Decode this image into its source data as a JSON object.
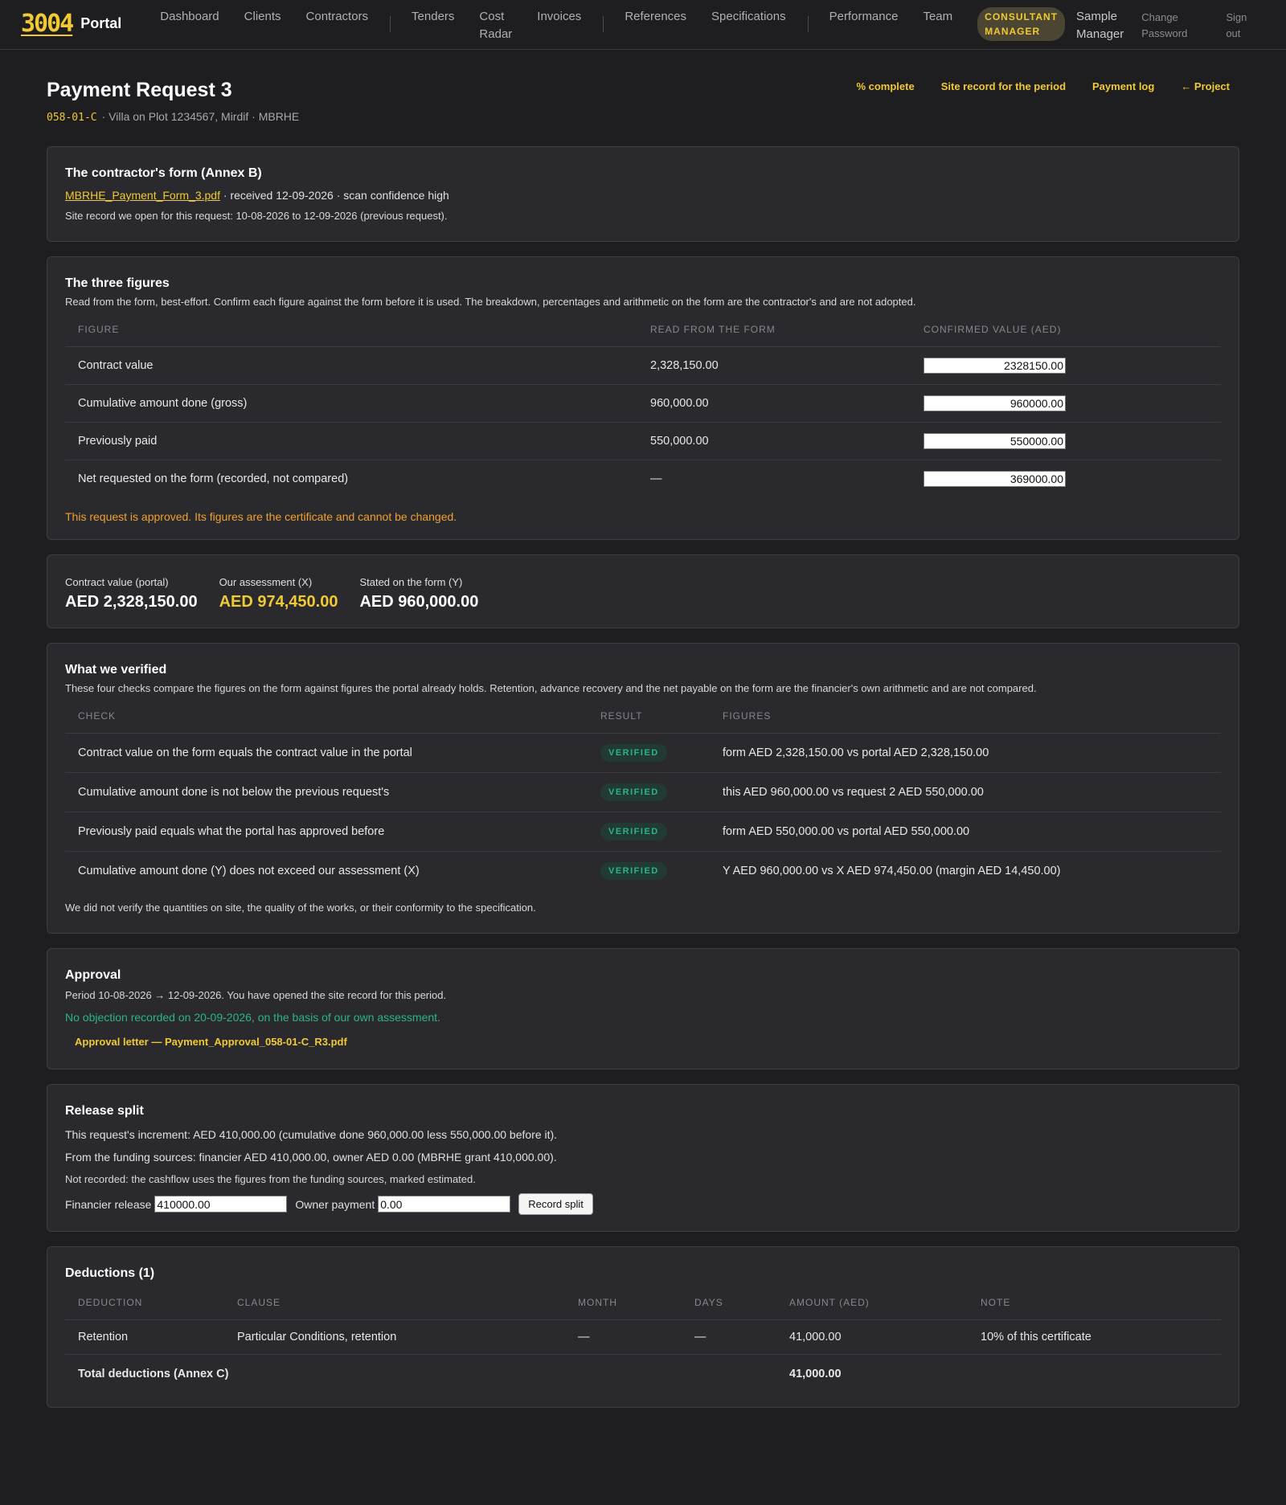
{
  "nav": {
    "brand_number": "3004",
    "brand_word": "Portal",
    "links": [
      "Dashboard",
      "Clients",
      "Contractors",
      "Tenders",
      "Cost\nRadar",
      "Invoices",
      "References",
      "Specifications",
      "Performance",
      "Team"
    ],
    "role": "CONSULTANT\nMANAGER",
    "user": "Sample\nManager",
    "change_password": "Change\nPassword",
    "sign_out": "Sign\nout"
  },
  "header": {
    "title": "Payment Request 3",
    "code": "058-01-C",
    "subtitle": "· Villa on Plot 1234567, Mirdif  · MBRHE",
    "links": [
      "% complete",
      "Site record for the period",
      "Payment log",
      "← Project"
    ]
  },
  "contractor_form": {
    "title": "The contractor's form (Annex B)",
    "file": "MBRHE_Payment_Form_3.pdf",
    "file_meta": " · received 12-09-2026 · scan confidence high",
    "site_record": "Site record we open for this request: 10-08-2026 to 12-09-2026 (previous request)."
  },
  "three_figures": {
    "title": "The three figures",
    "description": "Read from the form, best-effort. Confirm each figure against the form before it is used. The breakdown, percentages and arithmetic on the form are the contractor's and are not adopted.",
    "headers": [
      "FIGURE",
      "READ FROM THE FORM",
      "CONFIRMED VALUE (AED)"
    ],
    "rows": [
      {
        "figure": "Contract value",
        "read": "2,328,150.00",
        "confirmed": "2328150.00"
      },
      {
        "figure": "Cumulative amount done (gross)",
        "read": "960,000.00",
        "confirmed": "960000.00"
      },
      {
        "figure": "Previously paid",
        "read": "550,000.00",
        "confirmed": "550000.00"
      },
      {
        "figure": "Net requested on the form (recorded, not compared)",
        "read": "—",
        "confirmed": "369000.00"
      }
    ],
    "warning": "This request is approved. Its figures are the certificate and cannot be changed."
  },
  "summary": {
    "contract_label": "Contract value (portal)",
    "contract_value": "AED 2,328,150.00",
    "assessment_label": "Our assessment (X)",
    "assessment_value": "AED 974,450.00",
    "stated_label": "Stated on the form (Y)",
    "stated_value": "AED 960,000.00"
  },
  "verified": {
    "title": "What we verified",
    "description": "These four checks compare the figures on the form against figures the portal already holds. Retention, advance recovery and the net payable on the form are the financier's own arithmetic and are not compared.",
    "headers": [
      "CHECK",
      "RESULT",
      "FIGURES"
    ],
    "rows": [
      {
        "check": "Contract value on the form equals the contract value in the portal",
        "result": "VERIFIED",
        "figures": "form AED 2,328,150.00 vs portal AED 2,328,150.00"
      },
      {
        "check": "Cumulative amount done is not below the previous request's",
        "result": "VERIFIED",
        "figures": "this AED 960,000.00 vs request 2 AED 550,000.00"
      },
      {
        "check": "Previously paid equals what the portal has approved before",
        "result": "VERIFIED",
        "figures": "form AED 550,000.00 vs portal AED 550,000.00"
      },
      {
        "check": "Cumulative amount done (Y) does not exceed our assessment (X)",
        "result": "VERIFIED",
        "figures": "Y AED 960,000.00 vs X AED 974,450.00 (margin AED 14,450.00)"
      }
    ],
    "note": "We did not verify the quantities on site, the quality of the works, or their conformity to the specification."
  },
  "approval": {
    "title": "Approval",
    "period": "Period 10-08-2026 → 12-09-2026. You have opened the site record for this period.",
    "status": "No objection recorded on 20-09-2026, on the basis of our own assessment.",
    "letter": "Approval letter — Payment_Approval_058-01-C_R3.pdf"
  },
  "release": {
    "title": "Release split",
    "increment": "This request's increment: AED 410,000.00 (cumulative done 960,000.00 less 550,000.00 before it).",
    "funding": "From the funding sources: financier AED 410,000.00, owner AED 0.00 (MBRHE grant 410,000.00).",
    "not_recorded": "Not recorded: the cashflow uses the figures from the funding sources, marked estimated.",
    "financier_label": "Financier release",
    "financier_value": "410000.00",
    "owner_label": "Owner payment",
    "owner_value": "0.00",
    "button": "Record split"
  },
  "deductions": {
    "title": "Deductions (1)",
    "headers": [
      "DEDUCTION",
      "CLAUSE",
      "MONTH",
      "DAYS",
      "AMOUNT (AED)",
      "NOTE"
    ],
    "rows": [
      {
        "deduction": "Retention",
        "clause": "Particular Conditions, retention",
        "month": "—",
        "days": "—",
        "amount": "41,000.00",
        "note": "10% of this certificate"
      }
    ],
    "total_label": "Total deductions (Annex C)",
    "total_value": "41,000.00"
  },
  "colors": {
    "accent": "#f0c933",
    "success": "#2bb389",
    "warning": "#f0a030",
    "background": "#1e1e21",
    "card": "#2a2a2e"
  }
}
